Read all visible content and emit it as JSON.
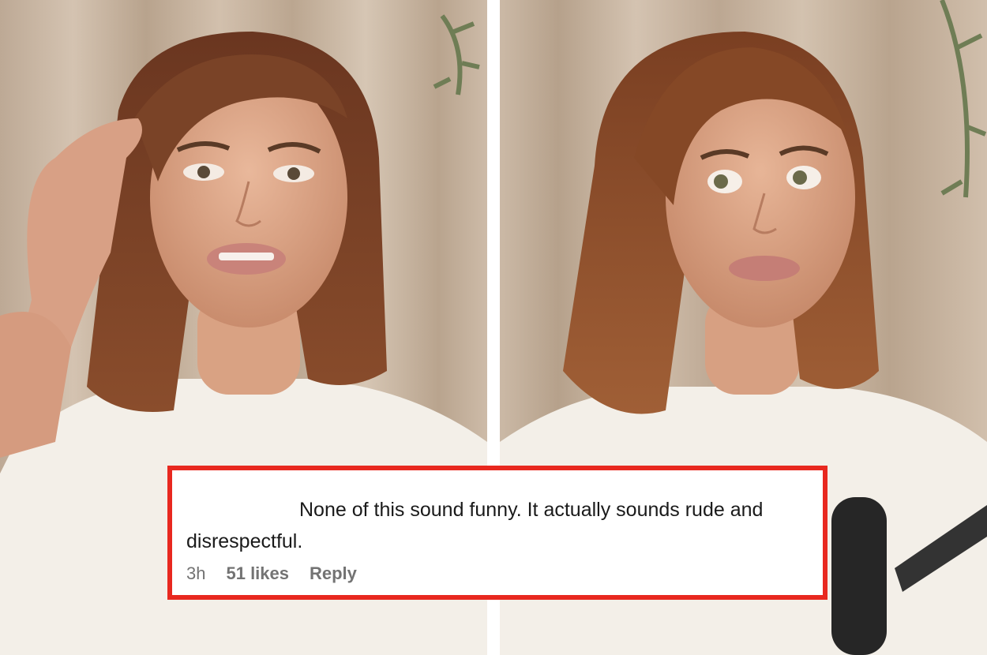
{
  "comment": {
    "text": "None of this sound funny. It actually sounds rude and disrespectful.",
    "time": "3h",
    "likes": "51 likes",
    "reply_label": "Reply"
  },
  "colors": {
    "highlight_border": "#e8281f",
    "meta_text": "#737373",
    "background_curtain": "#c9b7a6",
    "hair": "#7a4327",
    "shirt": "#f3efe8"
  }
}
